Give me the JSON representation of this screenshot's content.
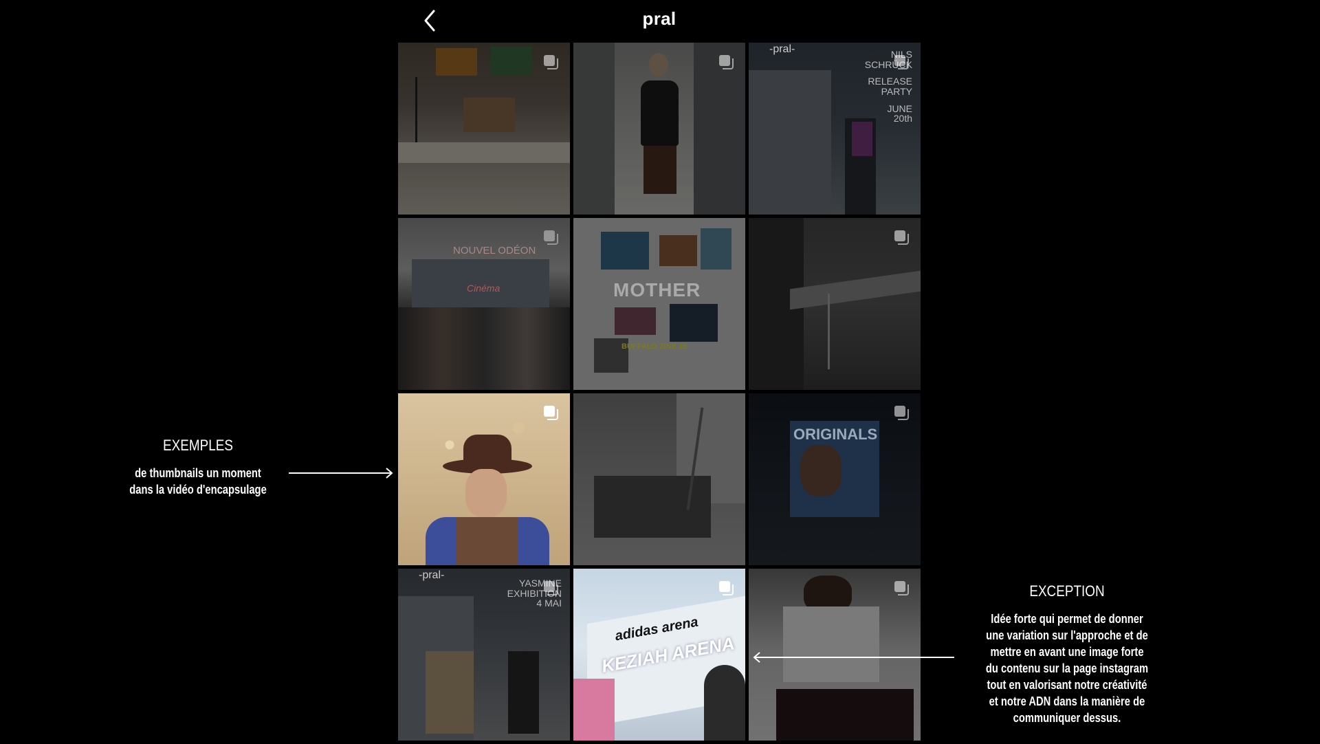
{
  "header": {
    "title": "pral"
  },
  "tiles": [
    {
      "label": ""
    },
    {
      "label": ""
    },
    {
      "lines": [
        "NILS",
        "SCHRÜCK",
        "",
        "RELEASE",
        "PARTY",
        "",
        "JUNE",
        "20th"
      ],
      "logo": "-pral-"
    },
    {
      "sign": "NOUVEL ODÉON",
      "neon": "Cinéma"
    },
    {
      "headline": "MOTHER",
      "sub": "BUFFALO ZINE 19"
    },
    {
      "label": ""
    },
    {
      "label": ""
    },
    {
      "label": ""
    },
    {
      "billboard": "ORIGINALS"
    },
    {
      "logo": "-pral-",
      "lines": [
        "YASMINE",
        "EXHIBITION",
        "4 MAI"
      ]
    },
    {
      "brand": "adidas arena",
      "name": "KEZIAH ARENA"
    },
    {
      "label": ""
    }
  ],
  "annotations": {
    "left": {
      "title": "EXEMPLES",
      "line1": "de thumbnails un moment",
      "line2": "dans la vidéo d'encapsulage"
    },
    "right": {
      "title": "EXCEPTION",
      "lines": [
        "Idée forte qui permet de donner",
        "une variation sur l'approche et de",
        "mettre en avant une image forte",
        "du contenu sur la page instagram",
        "tout en valorisant notre créativité",
        "et notre ADN dans la manière de",
        "communiquer dessus."
      ]
    }
  },
  "icons": {
    "back": "chevron-left-icon",
    "multi": "multiple-posts-icon"
  }
}
